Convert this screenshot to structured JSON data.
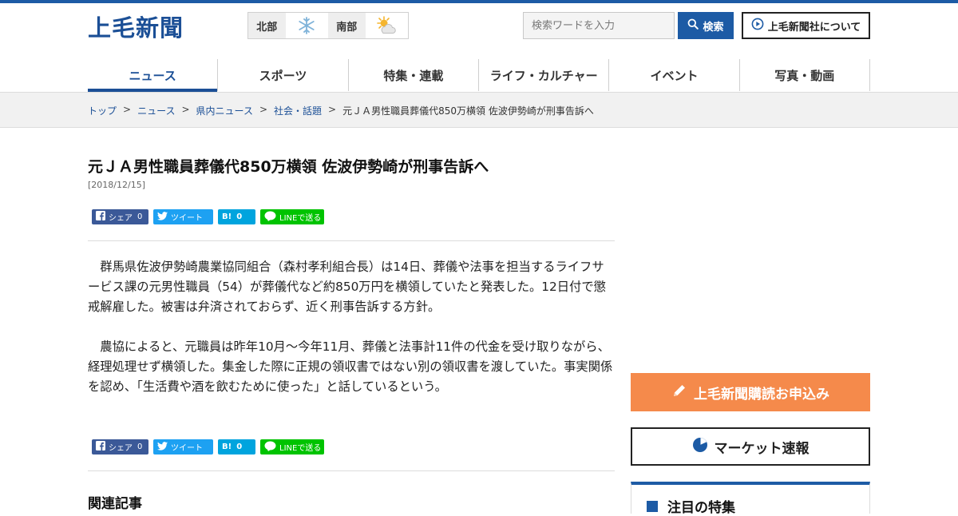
{
  "header": {
    "logo": "上毛新聞",
    "weather": [
      {
        "region": "北部",
        "icon": "snow-icon"
      },
      {
        "region": "南部",
        "icon": "sun-cloud-icon"
      }
    ],
    "search_placeholder": "検索ワードを入力",
    "search_label": "検索",
    "about_label": "上毛新聞社について"
  },
  "nav": {
    "items": [
      {
        "label": "ニュース",
        "active": true
      },
      {
        "label": "スポーツ"
      },
      {
        "label": "特集・連載"
      },
      {
        "label": "ライフ・カルチャー"
      },
      {
        "label": "イベント"
      },
      {
        "label": "写真・動画"
      }
    ]
  },
  "breadcrumb": {
    "items": [
      "トップ",
      "ニュース",
      "県内ニュース",
      "社会・話題"
    ],
    "current": "元ＪＡ男性職員葬儀代850万横領 佐波伊勢崎が刑事告訴へ",
    "separator": ">"
  },
  "article": {
    "title": "元ＪＡ男性職員葬儀代850万横領 佐波伊勢崎が刑事告訴へ",
    "date": "[2018/12/15]",
    "paragraphs": [
      "群馬県佐波伊勢崎農業協同組合（森村孝利組合長）は14日、葬儀や法事を担当するライフサービス課の元男性職員（54）が葬儀代など約850万円を横領していたと発表した。12日付で懲戒解雇した。被害は弁済されておらず、近く刑事告訴する方針。",
      "農協によると、元職員は昨年10月～今年11月、葬儀と法事計11件の代金を受け取りながら、経理処理せず横領した。集金した際に正規の領収書ではない別の領収書を渡していた。事実関係を認め、「生活費や酒を飲むために使った」と話しているという。"
    ],
    "related_heading": "関連記事"
  },
  "share": {
    "facebook_label": "シェア",
    "facebook_count": "0",
    "twitter_label": "ツイート",
    "hatena_label": "B!",
    "hatena_count": "0",
    "line_label": "LINEで送る"
  },
  "sidebar": {
    "subscribe_label": "上毛新聞購読お申込み",
    "market_label": "マーケット速報",
    "feature_heading": "注目の特集"
  },
  "colors": {
    "brand": "#1d5ba5",
    "subscribe": "#f58a4b",
    "facebook": "#3b5998",
    "twitter": "#1da1f2",
    "hatena": "#00a4de",
    "line": "#00c300"
  }
}
